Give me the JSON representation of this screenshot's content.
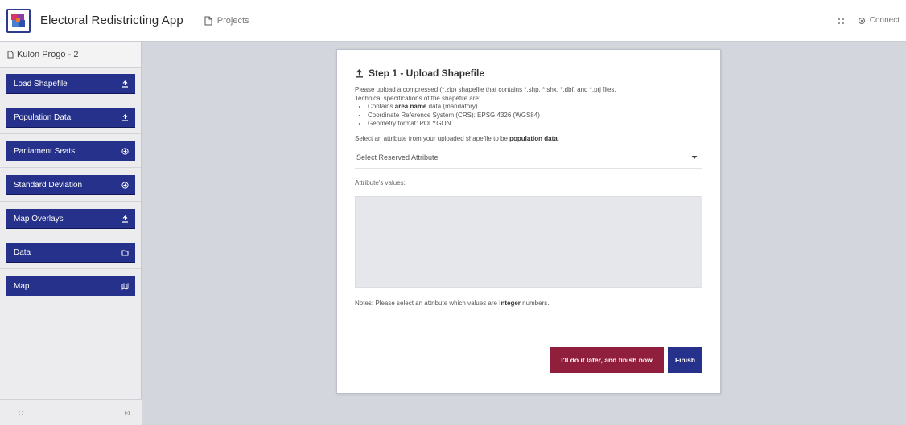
{
  "app": {
    "title": "Electoral Redistricting App"
  },
  "topbar": {
    "projects_label": "Projects",
    "connect_label": "Connect"
  },
  "sidebar": {
    "project_name": "Kulon Progo - 2",
    "items": [
      {
        "label": "Load Shapefile",
        "icon": "upload-icon"
      },
      {
        "label": "Population Data",
        "icon": "upload-icon"
      },
      {
        "label": "Parliament Seats",
        "icon": "plus-circle-icon"
      },
      {
        "label": "Standard Deviation",
        "icon": "plus-circle-icon"
      },
      {
        "label": "Map Overlays",
        "icon": "upload-icon"
      },
      {
        "label": "Data",
        "icon": "folder-icon"
      },
      {
        "label": "Map",
        "icon": "map-icon"
      }
    ]
  },
  "dialog": {
    "title": "Step 1 - Upload Shapefile",
    "desc_line1": "Please upload a compressed (*.zip) shapefile that contains *.shp, *.shx, *.dbf, and *.prj files.",
    "desc_line2": "Technical specifications of the shapefile are:",
    "spec1_prefix": "Contains ",
    "spec1_bold": "area name",
    "spec1_suffix": " data (mandatory).",
    "spec2": "Coordinate Reference System (CRS): EPSG:4326 (WGS84)",
    "spec3": "Geometry format: POLYGON",
    "select_prompt_prefix": "Select an attribute from your uploaded shapefile to be ",
    "select_prompt_bold": "population data",
    "select_prompt_suffix": ".",
    "select_placeholder": "Select Reserved Attribute",
    "attr_label": "Attribute's values:",
    "notes_prefix": "Notes: Please select an attribute which values are ",
    "notes_bold": "integer",
    "notes_suffix": " numbers.",
    "later_button": "I'll do it later, and finish now",
    "finish_button": "Finish"
  },
  "colors": {
    "primary": "#25318a",
    "later_button": "#8f1f3d",
    "background": "#d3d6dc"
  }
}
